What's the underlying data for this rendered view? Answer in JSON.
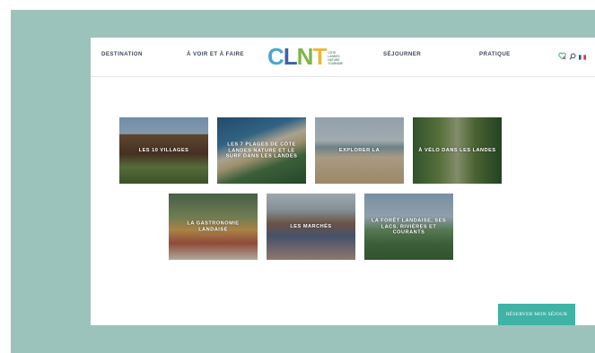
{
  "nav": {
    "destination": "DESTINATION",
    "voir_faire": "À VOIR ET À FAIRE",
    "sejourner": "SÉJOURNER",
    "pratique": "PRATIQUE"
  },
  "logo": {
    "letters": [
      "C",
      "L",
      "N",
      "T"
    ],
    "sub": [
      "CÔTE",
      "LANDES",
      "NATURE",
      "TOURISME"
    ],
    "colors": [
      "#4aa8c9",
      "#3f5fa8",
      "#7fb547",
      "#e8b83a"
    ]
  },
  "header_icons": [
    "heart-icon",
    "search-icon",
    "flag-fr-icon"
  ],
  "tiles": [
    {
      "label": "LES 10 VILLAGES"
    },
    {
      "label": "LES 7 PLAGES DE CÔTE LANDES NATURE ET LE SURF DANS LES LANDES"
    },
    {
      "label": "EXPLORER LA"
    },
    {
      "label": "À VÉLO DANS LES LANDES"
    },
    {
      "label": "LA GASTRONOMIE LANDAISE"
    },
    {
      "label": "LES MARCHÉS"
    },
    {
      "label": "LA FORÊT LANDAISE, SES LACS, RIVIÈRES ET COURANTS"
    }
  ],
  "book_button": "RÉSERVER MON SÉJOUR",
  "colors": {
    "frame": "#9cc3bb",
    "accent": "#3fb3a5"
  }
}
